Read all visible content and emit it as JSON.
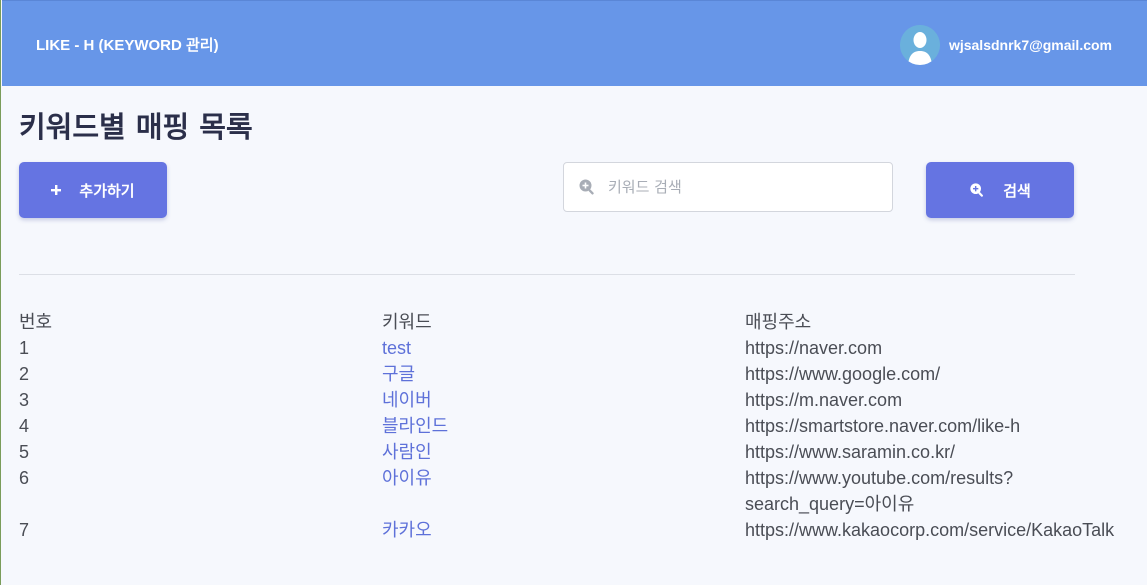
{
  "header": {
    "brand": "LIKE - H (KEYWORD 관리)",
    "user_email": "wjsalsdnrk7@gmail.com"
  },
  "page": {
    "title": "키워드별 매핑 목록"
  },
  "toolbar": {
    "add_label": "추가하기",
    "search_placeholder": "키워드 검색",
    "search_value": "",
    "search_label": "검색"
  },
  "table": {
    "headers": {
      "num": "번호",
      "keyword": "키워드",
      "url": "매핑주소"
    },
    "rows": [
      {
        "num": "1",
        "keyword": "test",
        "url": "https://naver.com"
      },
      {
        "num": "2",
        "keyword": "구글",
        "url": "https://www.google.com/"
      },
      {
        "num": "3",
        "keyword": "네이버",
        "url": "https://m.naver.com"
      },
      {
        "num": "4",
        "keyword": "블라인드",
        "url": "https://smartstore.naver.com/like-h"
      },
      {
        "num": "5",
        "keyword": "사람인",
        "url": "https://www.saramin.co.kr/"
      },
      {
        "num": "6",
        "keyword": "아이유",
        "url": "https://www.youtube.com/results?",
        "url2": "search_query=아이유"
      },
      {
        "num": "7",
        "keyword": "카카오",
        "url": "https://www.kakaocorp.com/service/KakaoTalk"
      }
    ]
  },
  "icons": {
    "avatar": "user-avatar-icon",
    "add": "plus-icon",
    "search": "search-icon"
  },
  "colors": {
    "header_bg": "#6796e8",
    "button_bg": "#6574e2",
    "link": "#5e71d9",
    "title": "#2b2f4a"
  }
}
